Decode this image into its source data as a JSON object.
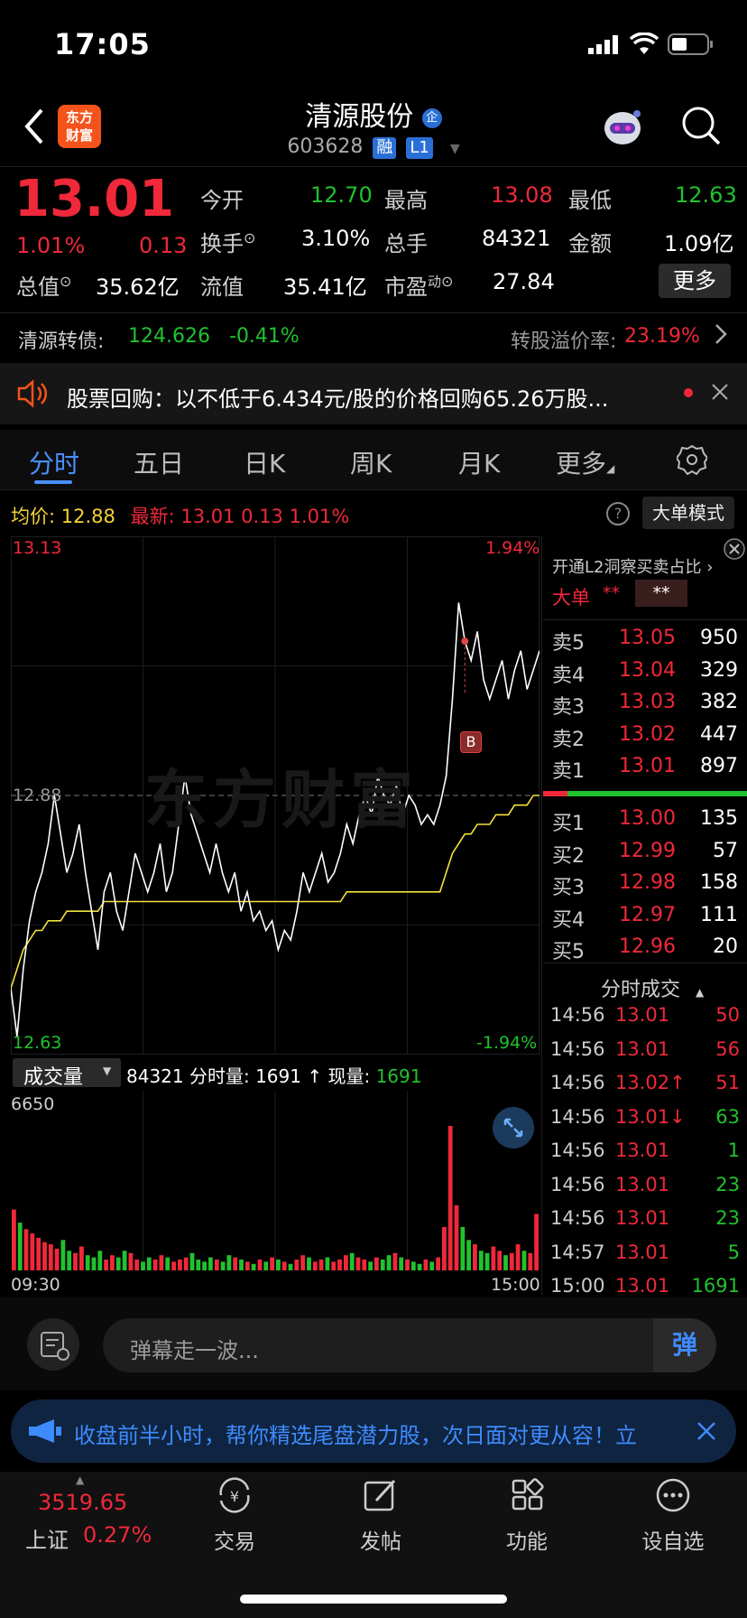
{
  "status": {
    "time": "17:05"
  },
  "header": {
    "logo_text": "东方财富",
    "title": "清源股份",
    "title_badge": "企",
    "code": "603628",
    "tags": [
      "融",
      "L1"
    ]
  },
  "quote": {
    "price": "13.01",
    "change_pct": "1.01%",
    "change": "0.13",
    "fields": [
      {
        "label": "今开",
        "value": "12.70",
        "color": "#22c12e"
      },
      {
        "label": "最高",
        "value": "13.08",
        "color": "#f0283a"
      },
      {
        "label": "最低",
        "value": "12.63",
        "color": "#22c12e"
      },
      {
        "label": "换手",
        "value": "3.10%",
        "color": "#ffffff"
      },
      {
        "label": "总手",
        "value": "84321",
        "color": "#ffffff"
      },
      {
        "label": "金额",
        "value": "1.09亿",
        "color": "#ffffff"
      },
      {
        "label": "总值",
        "value": "35.62亿",
        "color": "#ffffff"
      },
      {
        "label": "流值",
        "value": "35.41亿",
        "color": "#ffffff"
      },
      {
        "label": "市盈",
        "value": "27.84",
        "color": "#ffffff"
      }
    ],
    "pe_superscript": "动",
    "more_button": "更多"
  },
  "bond": {
    "label": "清源转债:",
    "price": "124.626",
    "change": "-0.41%",
    "premium_label": "转股溢价率:",
    "premium_value": "23.19%"
  },
  "notice": {
    "text": "股票回购：以不低于6.434元/股的价格回购65.26万股..."
  },
  "tabs": [
    {
      "label": "分时",
      "active": true
    },
    {
      "label": "五日",
      "active": false
    },
    {
      "label": "日K",
      "active": false
    },
    {
      "label": "周K",
      "active": false
    },
    {
      "label": "月K",
      "active": false
    },
    {
      "label": "更多",
      "active": false
    }
  ],
  "chart_info": {
    "avg_label": "均价:",
    "avg_value": "12.88",
    "latest_label": "最新:",
    "latest_value": "13.01",
    "latest_change": "0.13",
    "latest_pct": "1.01%",
    "help": "?",
    "mode_button": "大单模式"
  },
  "chart_data": {
    "type": "line",
    "y_top": "13.13",
    "y_mid": "12.88",
    "y_bottom": "12.63",
    "pct_top": "1.94%",
    "pct_bottom": "-1.94%",
    "ylim": [
      12.63,
      13.13
    ],
    "price_series": [
      12.68,
      12.63,
      12.7,
      12.75,
      12.78,
      12.8,
      12.83,
      12.88,
      12.84,
      12.8,
      12.82,
      12.85,
      12.8,
      12.76,
      12.72,
      12.78,
      12.8,
      12.76,
      12.74,
      12.78,
      12.82,
      12.8,
      12.78,
      12.8,
      12.83,
      12.78,
      12.8,
      12.85,
      12.9,
      12.86,
      12.84,
      12.82,
      12.8,
      12.83,
      12.8,
      12.78,
      12.8,
      12.76,
      12.78,
      12.75,
      12.76,
      12.74,
      12.75,
      12.72,
      12.74,
      12.73,
      12.76,
      12.8,
      12.78,
      12.8,
      12.82,
      12.79,
      12.8,
      12.82,
      12.85,
      12.83,
      12.86,
      12.88,
      12.86,
      12.9,
      12.88,
      12.87,
      12.89,
      12.86,
      12.88,
      12.87,
      12.85,
      12.86,
      12.85,
      12.87,
      12.9,
      12.98,
      13.08,
      13.04,
      13.02,
      13.05,
      13.0,
      12.98,
      13.0,
      13.02,
      12.98,
      13.01,
      13.03,
      12.99,
      13.01,
      13.03
    ],
    "avg_series": [
      12.68,
      12.7,
      12.72,
      12.73,
      12.74,
      12.74,
      12.75,
      12.75,
      12.75,
      12.76,
      12.76,
      12.76,
      12.76,
      12.76,
      12.76,
      12.77,
      12.77,
      12.77,
      12.77,
      12.77,
      12.77,
      12.77,
      12.77,
      12.77,
      12.77,
      12.77,
      12.77,
      12.77,
      12.77,
      12.77,
      12.77,
      12.77,
      12.77,
      12.77,
      12.77,
      12.77,
      12.77,
      12.77,
      12.77,
      12.77,
      12.77,
      12.77,
      12.77,
      12.77,
      12.77,
      12.77,
      12.77,
      12.77,
      12.77,
      12.77,
      12.77,
      12.77,
      12.77,
      12.77,
      12.78,
      12.78,
      12.78,
      12.78,
      12.78,
      12.78,
      12.78,
      12.78,
      12.78,
      12.78,
      12.78,
      12.78,
      12.78,
      12.78,
      12.78,
      12.78,
      12.8,
      12.82,
      12.83,
      12.84,
      12.84,
      12.85,
      12.85,
      12.85,
      12.86,
      12.86,
      12.86,
      12.87,
      12.87,
      12.87,
      12.88,
      12.88
    ],
    "marker": "B",
    "volume_label": "成交量",
    "volume_total": "84321",
    "volume_text": "分时量: 1691 ↑ 现量:",
    "volume_now": "1691",
    "volume_max": "6650",
    "time_start": "09:30",
    "time_end": "15:00",
    "volume_series": [
      2800,
      2200,
      1900,
      1700,
      1500,
      1300,
      1200,
      1000,
      1400,
      900,
      800,
      1100,
      700,
      600,
      900,
      500,
      700,
      600,
      900,
      800,
      500,
      400,
      600,
      500,
      700,
      600,
      400,
      500,
      600,
      800,
      500,
      400,
      600,
      500,
      400,
      700,
      600,
      500,
      400,
      300,
      500,
      400,
      600,
      500,
      400,
      300,
      500,
      700,
      600,
      400,
      500,
      600,
      400,
      500,
      700,
      800,
      600,
      500,
      400,
      600,
      500,
      700,
      800,
      600,
      500,
      400,
      300,
      500,
      400,
      600,
      2000,
      6650,
      3000,
      2000,
      1400,
      1200,
      900,
      800,
      1100,
      900,
      700,
      800,
      1200,
      900,
      800,
      2600
    ]
  },
  "order_book": {
    "header": "开通L2洞察买卖占比",
    "big_label": "大单",
    "big_v1": "**",
    "big_v2": "**",
    "sells": [
      {
        "label": "卖5",
        "price": "13.05",
        "vol": "950"
      },
      {
        "label": "卖4",
        "price": "13.04",
        "vol": "329"
      },
      {
        "label": "卖3",
        "price": "13.03",
        "vol": "382"
      },
      {
        "label": "卖2",
        "price": "13.02",
        "vol": "447"
      },
      {
        "label": "卖1",
        "price": "13.01",
        "vol": "897"
      }
    ],
    "buys": [
      {
        "label": "买1",
        "price": "13.00",
        "vol": "135"
      },
      {
        "label": "买2",
        "price": "12.99",
        "vol": "57"
      },
      {
        "label": "买3",
        "price": "12.98",
        "vol": "158"
      },
      {
        "label": "买4",
        "price": "12.97",
        "vol": "111"
      },
      {
        "label": "买5",
        "price": "12.96",
        "vol": "20"
      }
    ]
  },
  "ticks": {
    "header": "分时成交",
    "rows": [
      {
        "time": "14:56",
        "price": "13.01",
        "vol": "50",
        "vol_color": "#f0283a"
      },
      {
        "time": "14:56",
        "price": "13.01",
        "vol": "56",
        "vol_color": "#f0283a"
      },
      {
        "time": "14:56",
        "price": "13.02↑",
        "vol": "51",
        "vol_color": "#f0283a"
      },
      {
        "time": "14:56",
        "price": "13.01↓",
        "vol": "63",
        "vol_color": "#22c12e"
      },
      {
        "time": "14:56",
        "price": "13.01",
        "vol": "1",
        "vol_color": "#22c12e"
      },
      {
        "time": "14:56",
        "price": "13.01",
        "vol": "23",
        "vol_color": "#22c12e"
      },
      {
        "time": "14:56",
        "price": "13.01",
        "vol": "23",
        "vol_color": "#22c12e"
      },
      {
        "time": "14:57",
        "price": "13.01",
        "vol": "5",
        "vol_color": "#22c12e"
      },
      {
        "time": "15:00",
        "price": "13.01",
        "vol": "1691",
        "vol_color": "#22c12e"
      }
    ]
  },
  "comment": {
    "placeholder": "弹幕走一波...",
    "send_label": "弹"
  },
  "banner": {
    "text": "收盘前半小时，帮你精选尾盘潜力股，次日面对更从容！立"
  },
  "bottom_nav": {
    "index_value": "3519.65",
    "index_name": "上证",
    "index_pct": "0.27%",
    "items": [
      "交易",
      "发帖",
      "功能",
      "设自选"
    ]
  }
}
